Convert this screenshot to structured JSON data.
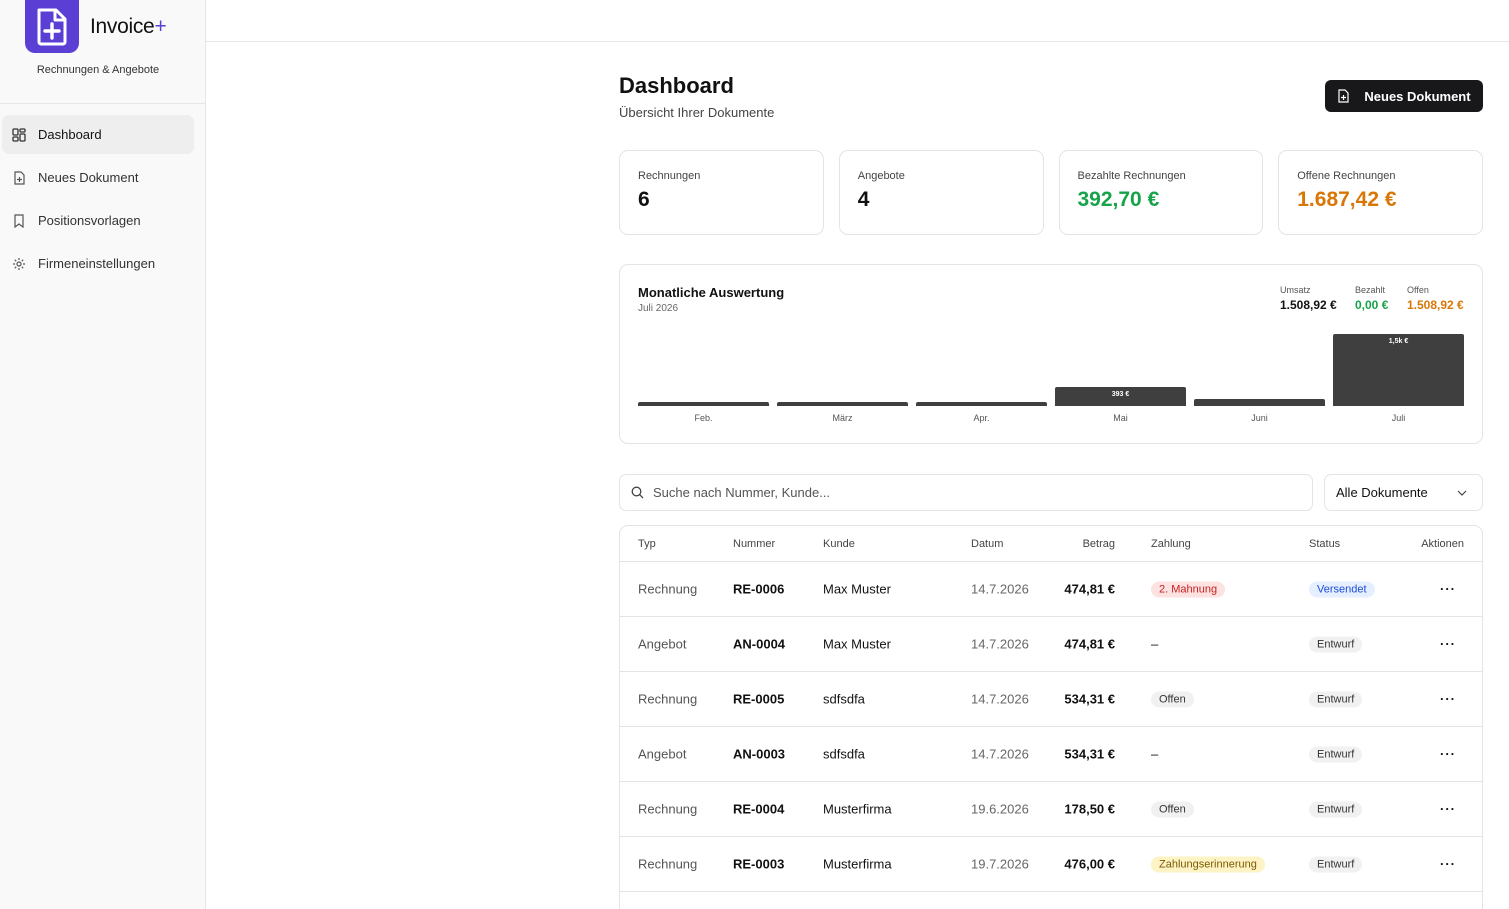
{
  "app": {
    "name": "Invoice",
    "name_suffix": "+",
    "subtitle": "Rechnungen & Angebote",
    "brand_color": "#5b3fd4"
  },
  "nav": [
    {
      "label": "Dashboard",
      "icon": "dashboard-icon",
      "active": true
    },
    {
      "label": "Neues Dokument",
      "icon": "file-plus-icon"
    },
    {
      "label": "Positionsvorlagen",
      "icon": "bookmark-icon"
    },
    {
      "label": "Firmeneinstellungen",
      "icon": "gear-icon"
    }
  ],
  "header": {
    "title": "Dashboard",
    "subtitle": "Übersicht Ihrer Dokumente",
    "new_button": "Neues Dokument"
  },
  "stats": [
    {
      "label": "Rechnungen",
      "value": "6",
      "color": "#111111"
    },
    {
      "label": "Angebote",
      "value": "4",
      "color": "#111111"
    },
    {
      "label": "Bezahlte Rechnungen",
      "value": "392,70 €",
      "color": "#16a34a"
    },
    {
      "label": "Offene Rechnungen",
      "value": "1.687,42 €",
      "color": "#d97706"
    }
  ],
  "monthly": {
    "title": "Monatliche Auswertung",
    "period": "Juli 2026",
    "summary": [
      {
        "label": "Umsatz",
        "value": "1.508,92 €",
        "color": "#111111"
      },
      {
        "label": "Bezahlt",
        "value": "0,00 €",
        "color": "#16a34a"
      },
      {
        "label": "Offen",
        "value": "1.508,92 €",
        "color": "#d97706"
      }
    ]
  },
  "chart_data": {
    "type": "bar",
    "categories": [
      "Feb.",
      "März",
      "Apr.",
      "Mai",
      "Juni",
      "Juli"
    ],
    "values": [
      0,
      0,
      0,
      393,
      150,
      1509
    ],
    "data_labels": [
      "",
      "",
      "",
      "393 €",
      "",
      "1,5k €"
    ],
    "ylim": [
      0,
      1509
    ]
  },
  "search": {
    "placeholder": "Suche nach Nummer, Kunde..."
  },
  "filter": {
    "selected": "Alle Dokumente"
  },
  "table": {
    "headers": [
      "Typ",
      "Nummer",
      "Kunde",
      "Datum",
      "Betrag",
      "Zahlung",
      "Status",
      "Aktionen"
    ],
    "rows": [
      {
        "typ": "Rechnung",
        "nummer": "RE-0006",
        "kunde": "Max Muster",
        "datum": "14.7.2026",
        "betrag": "474,81 €",
        "zahlung": "2. Mahnung",
        "zahlung_style": "red",
        "status": "Versendet",
        "status_style": "blue",
        "actions": "···"
      },
      {
        "typ": "Angebot",
        "nummer": "AN-0004",
        "kunde": "Max Muster",
        "datum": "14.7.2026",
        "betrag": "474,81 €",
        "zahlung": "–",
        "zahlung_style": "none",
        "status": "Entwurf",
        "status_style": "gray",
        "actions": "···"
      },
      {
        "typ": "Rechnung",
        "nummer": "RE-0005",
        "kunde": "sdfsdfa",
        "datum": "14.7.2026",
        "betrag": "534,31 €",
        "zahlung": "Offen",
        "zahlung_style": "gray",
        "status": "Entwurf",
        "status_style": "gray",
        "actions": "···"
      },
      {
        "typ": "Angebot",
        "nummer": "AN-0003",
        "kunde": "sdfsdfa",
        "datum": "14.7.2026",
        "betrag": "534,31 €",
        "zahlung": "–",
        "zahlung_style": "none",
        "status": "Entwurf",
        "status_style": "gray",
        "actions": "···"
      },
      {
        "typ": "Rechnung",
        "nummer": "RE-0004",
        "kunde": "Musterfirma",
        "datum": "19.6.2026",
        "betrag": "178,50 €",
        "zahlung": "Offen",
        "zahlung_style": "gray",
        "status": "Entwurf",
        "status_style": "gray",
        "actions": "···"
      },
      {
        "typ": "Rechnung",
        "nummer": "RE-0003",
        "kunde": "Musterfirma",
        "datum": "19.7.2026",
        "betrag": "476,00 €",
        "zahlung": "Zahlungserinnerung",
        "zahlung_style": "yellow",
        "status": "Entwurf",
        "status_style": "gray",
        "actions": "···"
      }
    ]
  }
}
